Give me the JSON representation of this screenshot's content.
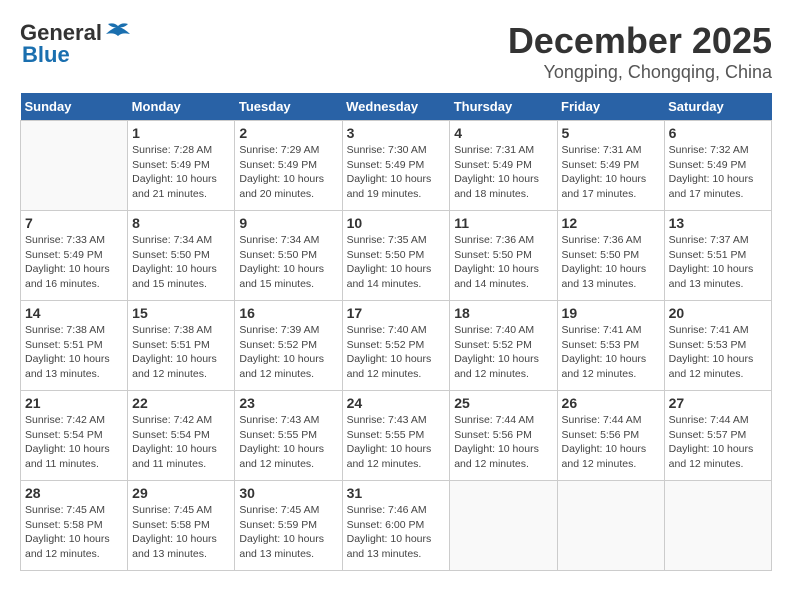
{
  "header": {
    "logo_general": "General",
    "logo_blue": "Blue",
    "month_year": "December 2025",
    "location": "Yongping, Chongqing, China"
  },
  "weekdays": [
    "Sunday",
    "Monday",
    "Tuesday",
    "Wednesday",
    "Thursday",
    "Friday",
    "Saturday"
  ],
  "weeks": [
    [
      {
        "day": "",
        "info": ""
      },
      {
        "day": "1",
        "info": "Sunrise: 7:28 AM\nSunset: 5:49 PM\nDaylight: 10 hours\nand 21 minutes."
      },
      {
        "day": "2",
        "info": "Sunrise: 7:29 AM\nSunset: 5:49 PM\nDaylight: 10 hours\nand 20 minutes."
      },
      {
        "day": "3",
        "info": "Sunrise: 7:30 AM\nSunset: 5:49 PM\nDaylight: 10 hours\nand 19 minutes."
      },
      {
        "day": "4",
        "info": "Sunrise: 7:31 AM\nSunset: 5:49 PM\nDaylight: 10 hours\nand 18 minutes."
      },
      {
        "day": "5",
        "info": "Sunrise: 7:31 AM\nSunset: 5:49 PM\nDaylight: 10 hours\nand 17 minutes."
      },
      {
        "day": "6",
        "info": "Sunrise: 7:32 AM\nSunset: 5:49 PM\nDaylight: 10 hours\nand 17 minutes."
      }
    ],
    [
      {
        "day": "7",
        "info": "Sunrise: 7:33 AM\nSunset: 5:49 PM\nDaylight: 10 hours\nand 16 minutes."
      },
      {
        "day": "8",
        "info": "Sunrise: 7:34 AM\nSunset: 5:50 PM\nDaylight: 10 hours\nand 15 minutes."
      },
      {
        "day": "9",
        "info": "Sunrise: 7:34 AM\nSunset: 5:50 PM\nDaylight: 10 hours\nand 15 minutes."
      },
      {
        "day": "10",
        "info": "Sunrise: 7:35 AM\nSunset: 5:50 PM\nDaylight: 10 hours\nand 14 minutes."
      },
      {
        "day": "11",
        "info": "Sunrise: 7:36 AM\nSunset: 5:50 PM\nDaylight: 10 hours\nand 14 minutes."
      },
      {
        "day": "12",
        "info": "Sunrise: 7:36 AM\nSunset: 5:50 PM\nDaylight: 10 hours\nand 13 minutes."
      },
      {
        "day": "13",
        "info": "Sunrise: 7:37 AM\nSunset: 5:51 PM\nDaylight: 10 hours\nand 13 minutes."
      }
    ],
    [
      {
        "day": "14",
        "info": "Sunrise: 7:38 AM\nSunset: 5:51 PM\nDaylight: 10 hours\nand 13 minutes."
      },
      {
        "day": "15",
        "info": "Sunrise: 7:38 AM\nSunset: 5:51 PM\nDaylight: 10 hours\nand 12 minutes."
      },
      {
        "day": "16",
        "info": "Sunrise: 7:39 AM\nSunset: 5:52 PM\nDaylight: 10 hours\nand 12 minutes."
      },
      {
        "day": "17",
        "info": "Sunrise: 7:40 AM\nSunset: 5:52 PM\nDaylight: 10 hours\nand 12 minutes."
      },
      {
        "day": "18",
        "info": "Sunrise: 7:40 AM\nSunset: 5:52 PM\nDaylight: 10 hours\nand 12 minutes."
      },
      {
        "day": "19",
        "info": "Sunrise: 7:41 AM\nSunset: 5:53 PM\nDaylight: 10 hours\nand 12 minutes."
      },
      {
        "day": "20",
        "info": "Sunrise: 7:41 AM\nSunset: 5:53 PM\nDaylight: 10 hours\nand 12 minutes."
      }
    ],
    [
      {
        "day": "21",
        "info": "Sunrise: 7:42 AM\nSunset: 5:54 PM\nDaylight: 10 hours\nand 11 minutes."
      },
      {
        "day": "22",
        "info": "Sunrise: 7:42 AM\nSunset: 5:54 PM\nDaylight: 10 hours\nand 11 minutes."
      },
      {
        "day": "23",
        "info": "Sunrise: 7:43 AM\nSunset: 5:55 PM\nDaylight: 10 hours\nand 12 minutes."
      },
      {
        "day": "24",
        "info": "Sunrise: 7:43 AM\nSunset: 5:55 PM\nDaylight: 10 hours\nand 12 minutes."
      },
      {
        "day": "25",
        "info": "Sunrise: 7:44 AM\nSunset: 5:56 PM\nDaylight: 10 hours\nand 12 minutes."
      },
      {
        "day": "26",
        "info": "Sunrise: 7:44 AM\nSunset: 5:56 PM\nDaylight: 10 hours\nand 12 minutes."
      },
      {
        "day": "27",
        "info": "Sunrise: 7:44 AM\nSunset: 5:57 PM\nDaylight: 10 hours\nand 12 minutes."
      }
    ],
    [
      {
        "day": "28",
        "info": "Sunrise: 7:45 AM\nSunset: 5:58 PM\nDaylight: 10 hours\nand 12 minutes."
      },
      {
        "day": "29",
        "info": "Sunrise: 7:45 AM\nSunset: 5:58 PM\nDaylight: 10 hours\nand 13 minutes."
      },
      {
        "day": "30",
        "info": "Sunrise: 7:45 AM\nSunset: 5:59 PM\nDaylight: 10 hours\nand 13 minutes."
      },
      {
        "day": "31",
        "info": "Sunrise: 7:46 AM\nSunset: 6:00 PM\nDaylight: 10 hours\nand 13 minutes."
      },
      {
        "day": "",
        "info": ""
      },
      {
        "day": "",
        "info": ""
      },
      {
        "day": "",
        "info": ""
      }
    ]
  ]
}
